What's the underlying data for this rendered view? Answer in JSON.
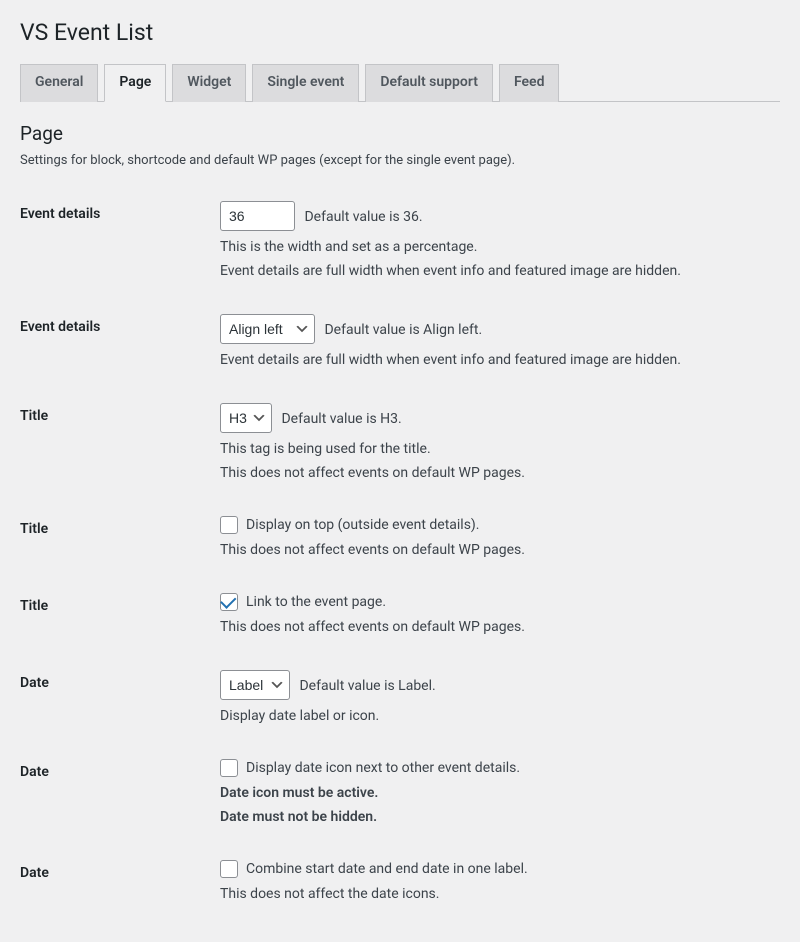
{
  "page_title": "VS Event List",
  "tabs": [
    "General",
    "Page",
    "Widget",
    "Single event",
    "Default support",
    "Feed"
  ],
  "active_tab": "Page",
  "section_heading": "Page",
  "section_desc": "Settings for block, shortcode and default WP pages (except for the single event page).",
  "rows": {
    "event_details_width": {
      "label": "Event details",
      "value": "36",
      "inline": "Default value is 36.",
      "desc1": "This is the width and set as a percentage.",
      "desc2": "Event details are full width when event info and featured image are hidden."
    },
    "event_details_align": {
      "label": "Event details",
      "value": "Align left",
      "inline": "Default value is Align left.",
      "desc1": "Event details are full width when event info and featured image are hidden."
    },
    "title_tag": {
      "label": "Title",
      "value": "H3",
      "inline": "Default value is H3.",
      "desc1": "This tag is being used for the title.",
      "desc2": "This does not affect events on default WP pages."
    },
    "title_top": {
      "label": "Title",
      "cb_label": "Display on top (outside event details).",
      "desc1": "This does not affect events on default WP pages."
    },
    "title_link": {
      "label": "Title",
      "cb_label": "Link to the event page.",
      "desc1": "This does not affect events on default WP pages."
    },
    "date_label": {
      "label": "Date",
      "value": "Label",
      "inline": "Default value is Label.",
      "desc1": "Display date label or icon."
    },
    "date_icon_next": {
      "label": "Date",
      "cb_label": "Display date icon next to other event details.",
      "desc1": "Date icon must be active.",
      "desc2": "Date must not be hidden."
    },
    "date_combine": {
      "label": "Date",
      "cb_label": "Combine start date and end date in one label.",
      "desc1": "This does not affect the date icons."
    }
  }
}
